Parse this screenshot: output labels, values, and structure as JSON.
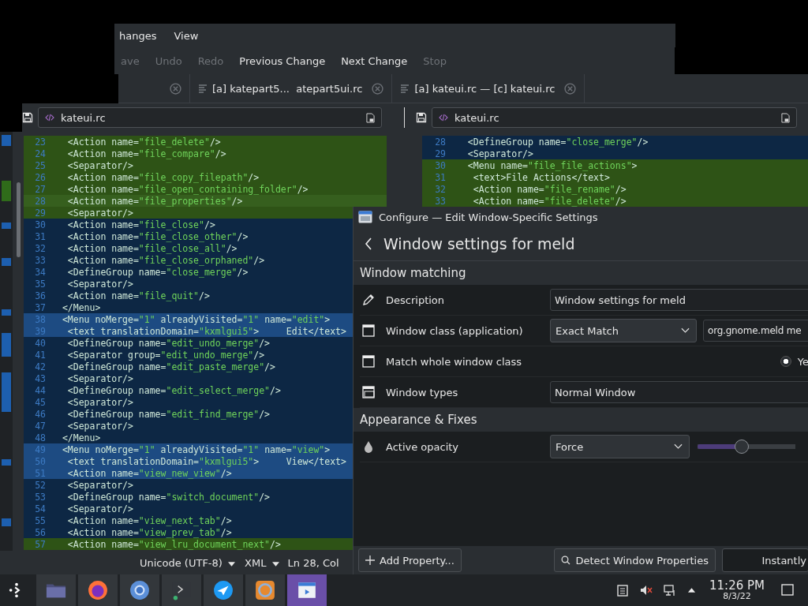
{
  "meld": {
    "menus": [
      {
        "label": "hanges"
      },
      {
        "label": "View"
      }
    ],
    "toolbar": [
      {
        "label": "ave",
        "disabled": true
      },
      {
        "label": "Undo",
        "disabled": true
      },
      {
        "label": "Redo",
        "disabled": true
      },
      {
        "label": "Previous Change",
        "disabled": false
      },
      {
        "label": "Next Change",
        "disabled": false
      },
      {
        "label": "Stop",
        "disabled": true
      }
    ],
    "tabs": [
      {
        "label": "[a] katepart5...  atepart5ui.rc"
      },
      {
        "label": "[a] kateui.rc — [c] kateui.rc"
      }
    ],
    "left_pane": {
      "file": "kateui.rc",
      "lines": [
        {
          "num": "23",
          "kind": "insert",
          "current": false,
          "text": "  <Action name=\"file_delete\"/>"
        },
        {
          "num": "24",
          "kind": "insert",
          "current": false,
          "text": "  <Action name=\"file_compare\"/>"
        },
        {
          "num": "25",
          "kind": "insert",
          "current": false,
          "text": "  <Separator/>"
        },
        {
          "num": "26",
          "kind": "insert",
          "current": false,
          "text": "  <Action name=\"file_copy_filepath\"/>"
        },
        {
          "num": "27",
          "kind": "insert",
          "current": false,
          "text": "  <Action name=\"file_open_containing_folder\"/>"
        },
        {
          "num": "28",
          "kind": "insert",
          "current": true,
          "text": "  <Action name=\"file_properties\"/>"
        },
        {
          "num": "29",
          "kind": "insert",
          "current": false,
          "text": "  <Separator/>"
        },
        {
          "num": "30",
          "kind": "change",
          "current": false,
          "text": "  <Action name=\"file_close\"/>"
        },
        {
          "num": "31",
          "kind": "change",
          "current": false,
          "text": "  <Action name=\"file_close_other\"/>"
        },
        {
          "num": "32",
          "kind": "change",
          "current": false,
          "text": "  <Action name=\"file_close_all\"/>"
        },
        {
          "num": "33",
          "kind": "change",
          "current": false,
          "text": "  <Action name=\"file_close_orphaned\"/>"
        },
        {
          "num": "34",
          "kind": "change",
          "current": false,
          "text": "  <DefineGroup name=\"close_merge\"/>"
        },
        {
          "num": "35",
          "kind": "change",
          "current": false,
          "text": "  <Separator/>"
        },
        {
          "num": "36",
          "kind": "change",
          "current": false,
          "text": "  <Action name=\"file_quit\"/>"
        },
        {
          "num": "37",
          "kind": "change",
          "current": false,
          "text": " </Menu>"
        },
        {
          "num": "38",
          "kind": "highlight",
          "current": false,
          "text": " <Menu noMerge=\"1\" alreadyVisited=\"1\" name=\"edit\">"
        },
        {
          "num": "39",
          "kind": "highlight",
          "current": false,
          "text": "  <text translationDomain=\"kxmlgui5\">     Edit</text>"
        },
        {
          "num": "40",
          "kind": "change",
          "current": false,
          "text": "  <DefineGroup name=\"edit_undo_merge\"/>"
        },
        {
          "num": "41",
          "kind": "change",
          "current": false,
          "text": "  <Separator group=\"edit_undo_merge\"/>"
        },
        {
          "num": "42",
          "kind": "change",
          "current": false,
          "text": "  <DefineGroup name=\"edit_paste_merge\"/>"
        },
        {
          "num": "43",
          "kind": "change",
          "current": false,
          "text": "  <Separator/>"
        },
        {
          "num": "44",
          "kind": "change",
          "current": false,
          "text": "  <DefineGroup name=\"edit_select_merge\"/>"
        },
        {
          "num": "45",
          "kind": "change",
          "current": false,
          "text": "  <Separator/>"
        },
        {
          "num": "46",
          "kind": "change",
          "current": false,
          "text": "  <DefineGroup name=\"edit_find_merge\"/>"
        },
        {
          "num": "47",
          "kind": "change",
          "current": false,
          "text": "  <Separator/>"
        },
        {
          "num": "48",
          "kind": "change",
          "current": false,
          "text": " </Menu>"
        },
        {
          "num": "49",
          "kind": "highlight",
          "current": false,
          "text": " <Menu noMerge=\"1\" alreadyVisited=\"1\" name=\"view\">"
        },
        {
          "num": "50",
          "kind": "highlight",
          "current": false,
          "text": "  <text translationDomain=\"kxmlgui5\">     View</text>"
        },
        {
          "num": "51",
          "kind": "highlight",
          "current": false,
          "text": "  <Action name=\"view_new_view\"/>"
        },
        {
          "num": "52",
          "kind": "change",
          "current": false,
          "text": "  <Separator/>"
        },
        {
          "num": "53",
          "kind": "change",
          "current": false,
          "text": "  <DefineGroup name=\"switch_document\"/>"
        },
        {
          "num": "54",
          "kind": "change",
          "current": false,
          "text": "  <Separator/>"
        },
        {
          "num": "55",
          "kind": "change",
          "current": false,
          "text": "  <Action name=\"view_next_tab\"/>"
        },
        {
          "num": "56",
          "kind": "change",
          "current": false,
          "text": "  <Action name=\"view_prev_tab\"/>"
        },
        {
          "num": "57",
          "kind": "insert",
          "current": false,
          "text": "  <Action name=\"view_lru_document_next\"/>"
        }
      ]
    },
    "right_pane": {
      "file": "kateui.rc",
      "lines": [
        {
          "num": "28",
          "kind": "change",
          "text": "  <DefineGroup name=\"close_merge\"/>"
        },
        {
          "num": "29",
          "kind": "change",
          "text": "  <Separator/>"
        },
        {
          "num": "30",
          "kind": "insert",
          "text": "  <Menu name=\"file_file_actions\">"
        },
        {
          "num": "31",
          "kind": "insert",
          "text": "   <text>File Actions</text>"
        },
        {
          "num": "32",
          "kind": "insert",
          "text": "   <Action name=\"file_rename\"/>"
        },
        {
          "num": "33",
          "kind": "insert",
          "text": "   <Action name=\"file_delete\"/>"
        }
      ]
    },
    "status": [
      "Unicode (UTF-8)",
      "XML"
    ],
    "position": "Ln 28, Col"
  },
  "dialog": {
    "title": "Configure — Edit Window-Specific Settings",
    "heading": "Window settings for meld",
    "sections": [
      {
        "title": "Window matching",
        "rows": [
          {
            "kind": "text",
            "label": "Description",
            "value": "Window settings for meld"
          },
          {
            "kind": "combo_text",
            "label": "Window class (application)",
            "combo": "Exact Match",
            "value": "org.gnome.meld me"
          },
          {
            "kind": "radio",
            "label": "Match whole window class",
            "option": "Ye",
            "selected": true
          },
          {
            "kind": "select",
            "label": "Window types",
            "value": "Normal Window"
          }
        ]
      },
      {
        "title": "Appearance & Fixes",
        "rows": [
          {
            "kind": "slider",
            "label": "Active opacity",
            "combo": "Force",
            "level": 0.44
          }
        ]
      }
    ],
    "buttons": [
      "Add Property...",
      "Detect Window Properties",
      "Instantly"
    ]
  },
  "taskbar": {
    "time": "11:26 PM",
    "date": "8/3/22"
  }
}
